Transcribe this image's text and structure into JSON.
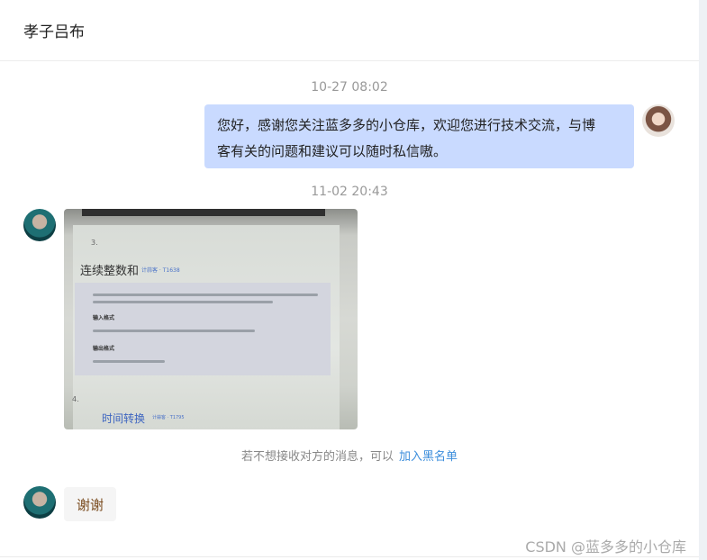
{
  "header": {
    "title": "孝子吕布"
  },
  "messages": [
    {
      "timestamp": "10-27 08:02",
      "sender": "me",
      "text_line1": "您好，感谢您关注蓝多多的小仓库，欢迎您进行技术交流，与博",
      "text_line2": "客有关的问题和建议可以随时私信嗷。"
    },
    {
      "timestamp": "11-02 20:43",
      "sender": "other",
      "type": "image",
      "image": {
        "problem_num_a": "3.",
        "problem_title_a": "连续整数和",
        "problem_link_a": "计蒜客 · T1638",
        "section_input": "输入格式",
        "section_output": "输出格式",
        "problem_num_b": "4.",
        "problem_title_b": "时间转换",
        "problem_link_b": "计蒜客 · T1795"
      }
    },
    {
      "sender": "other",
      "text": "谢谢"
    }
  ],
  "notice": {
    "text": "若不想接收对方的消息，可以",
    "link": "加入黑名单"
  },
  "watermark": "CSDN @蓝多多的小仓库",
  "colors": {
    "my_bubble": "#c9daff",
    "other_bubble": "#f5f5f5",
    "link": "#3c8edc"
  }
}
